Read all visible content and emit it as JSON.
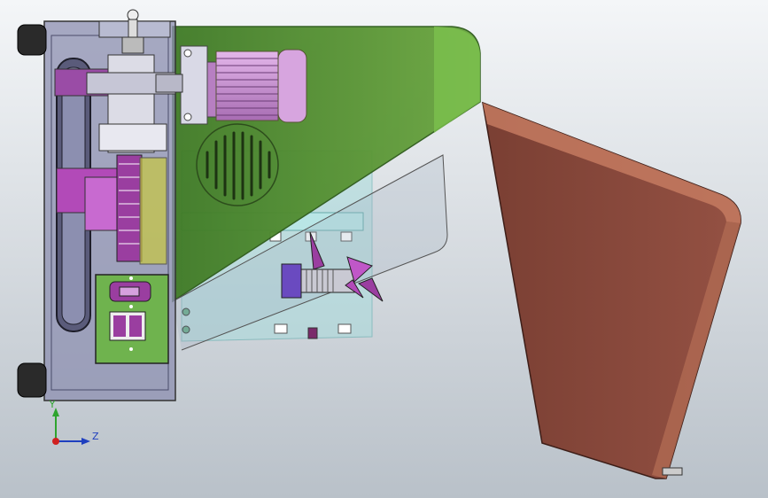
{
  "viewport": {
    "background_top": "#f4f6f8",
    "background_bottom": "#b9c1c9"
  },
  "triad": {
    "y_label": "Y",
    "z_label": "Z",
    "y_color": "#2ea42e",
    "z_color": "#1f3fbf",
    "origin_color": "#d02020"
  },
  "colors": {
    "frame": "#8c8fb0",
    "frame_dark": "#4a4c6a",
    "housing_green": "#4e8a2e",
    "housing_green_light": "#7fbf4e",
    "motor_purple": "#c98ad3",
    "belt": "#3a3a3a",
    "gear_magenta": "#b24ab8",
    "hopper": "#8a4a3c",
    "hopper_edge": "#c47a60",
    "panel_green": "#6fb34e",
    "cyan_frame": "#a6d9d9",
    "feet": "#2a2a2a"
  }
}
